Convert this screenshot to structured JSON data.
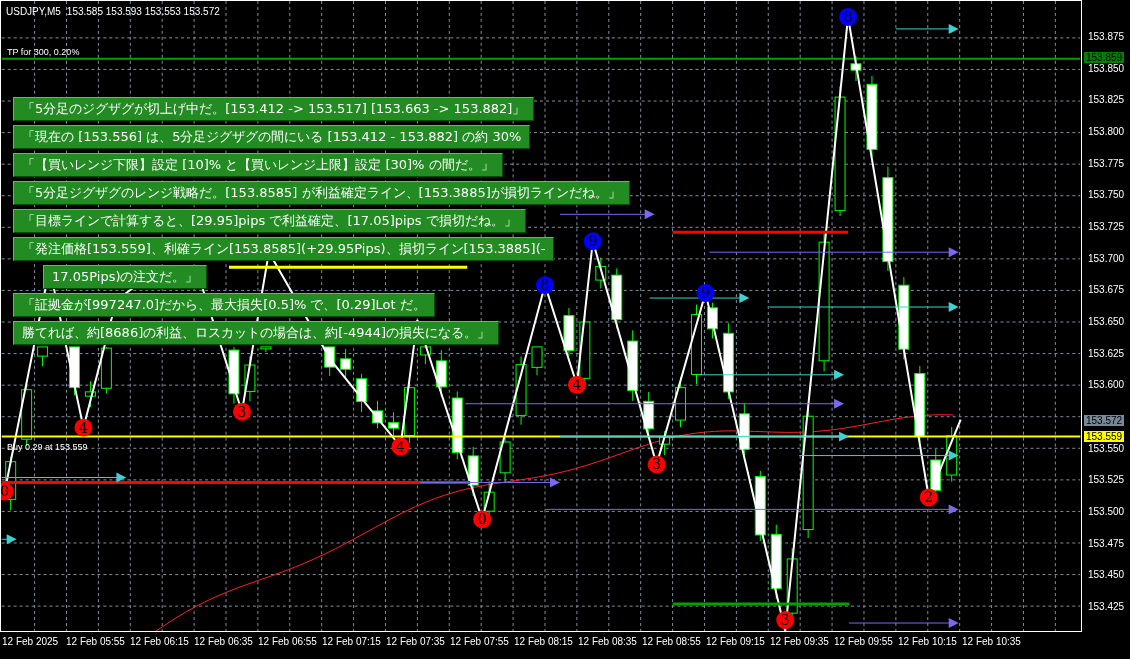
{
  "chart_header": {
    "symbol": "USDJPY,M5",
    "quote": "153.585 153.593 153.553 153.572"
  },
  "tp_label": "TP for 300, 0.20%",
  "order_label": "Buy 0.29 at 153.559",
  "messages": [
    {
      "kind": "line",
      "text": "「5分足のジグザグが切上げ中だ。[153.412 -> 153.517] [153.663 -> 153.882]」"
    },
    {
      "kind": "line",
      "text": "「現在の [153.556] は、5分足ジグザグの間にいる [153.412 - 153.882] の約 30%"
    },
    {
      "kind": "line",
      "text": "「【買いレンジ下限】設定 [10]% と【買いレンジ上限】設定 [30]% の間だ。」"
    },
    {
      "kind": "line",
      "text": "「5分足ジグザグのレンジ戦略だ。[153.8585] が利益確定ライン、[153.3885]が損切ラインだね。」"
    },
    {
      "kind": "line",
      "text": "「目標ラインで計算すると、[29.95]pips で利益確定、[17.05]pips で損切だね。」"
    },
    {
      "kind": "line",
      "text": "「発注価格[153.559]、利確ライン[153.8585](+29.95Pips)、損切ライン[153.3885](-"
    },
    {
      "kind": "continuation",
      "text": "17.05Pips)の注文だ。」"
    },
    {
      "kind": "line",
      "text": "「証拠金が[997247.0]だから、最大損失[0.5]% で、[0.29]Lot だ。"
    },
    {
      "kind": "line",
      "text": "勝てれば、約[8686]の利益、ロスカットの場合は、約[-4944]の損失になる。」"
    }
  ],
  "zigzag_markers": [
    {
      "label": "0",
      "color": "#ff0000"
    },
    {
      "label": "4",
      "color": "#ff0000"
    },
    {
      "label": "3",
      "color": "#ff0000"
    },
    {
      "label": "4",
      "color": "#ff0000"
    },
    {
      "label": "0",
      "color": "#ff0000"
    },
    {
      "label": "8",
      "color": "#0000ff"
    },
    {
      "label": "4",
      "color": "#ff0000"
    },
    {
      "label": "9",
      "color": "#0000ff"
    },
    {
      "label": "3",
      "color": "#ff0000"
    },
    {
      "label": "9",
      "color": "#0000ff"
    },
    {
      "label": "3",
      "color": "#ff0000"
    },
    {
      "label": "8",
      "color": "#0000ff"
    },
    {
      "label": "2",
      "color": "#ff0000"
    }
  ],
  "price_axis_upper": [
    "153.875",
    "153.850",
    "153.825",
    "153.800",
    "153.775",
    "153.750",
    "153.725",
    "153.700",
    "153.675",
    "153.650",
    "153.625",
    "153.600"
  ],
  "price_axis_lower": [
    "153.550",
    "153.525",
    "153.500",
    "153.475",
    "153.450",
    "153.425"
  ],
  "price_tags": [
    {
      "text": "153.859",
      "color": "#008000"
    },
    {
      "text": "153.572",
      "color": "#778899"
    },
    {
      "text": "153.559",
      "color": "#ffff00"
    }
  ],
  "time_axis": [
    "12 Feb 2025",
    "12 Feb 05:55",
    "12 Feb 06:15",
    "12 Feb 06:35",
    "12 Feb 06:55",
    "12 Feb 07:15",
    "12 Feb 07:35",
    "12 Feb 07:55",
    "12 Feb 08:15",
    "12 Feb 08:35",
    "12 Feb 08:55",
    "12 Feb 09:15",
    "12 Feb 09:35",
    "12 Feb 09:55",
    "12 Feb 10:15",
    "12 Feb 10:35"
  ]
}
